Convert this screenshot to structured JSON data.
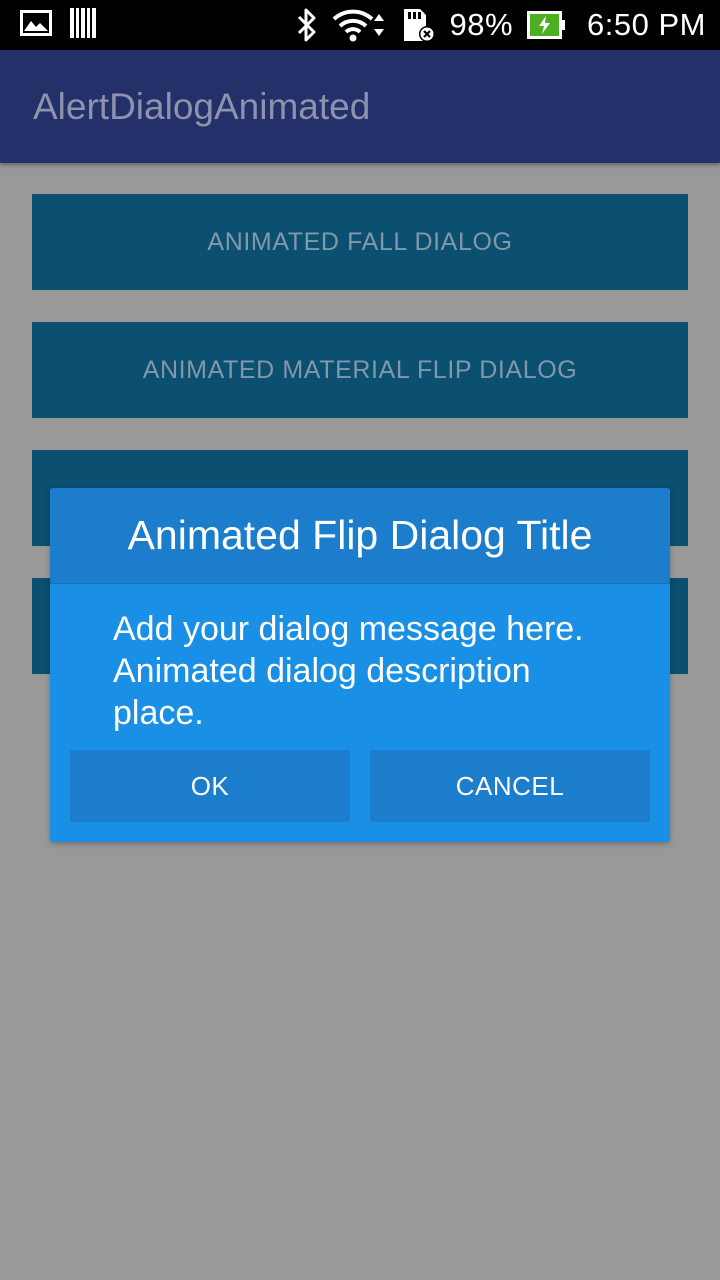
{
  "status_bar": {
    "battery_percent": "98%",
    "time": "6:50 PM",
    "icons": [
      "gallery-icon",
      "barcode-icon",
      "bluetooth-icon",
      "wifi-icon",
      "sd-card-icon",
      "battery-charging-icon"
    ],
    "battery_color": "#4caf1f"
  },
  "toolbar": {
    "title": "AlertDialogAnimated",
    "background": "#243069"
  },
  "main": {
    "buttons": [
      {
        "label": "ANIMATED FALL DIALOG"
      },
      {
        "label": "ANIMATED MATERIAL FLIP DIALOG"
      },
      {
        "label": ""
      },
      {
        "label": ""
      }
    ],
    "button_color": "#0b4f71"
  },
  "dialog": {
    "title": "Animated Flip Dialog Title",
    "message": "Add your dialog message here. Animated dialog description place.",
    "ok_label": "OK",
    "cancel_label": "CANCEL",
    "background": "#1a8fe6",
    "header_color": "#1b7dcc"
  },
  "overlay_color": "#999999"
}
